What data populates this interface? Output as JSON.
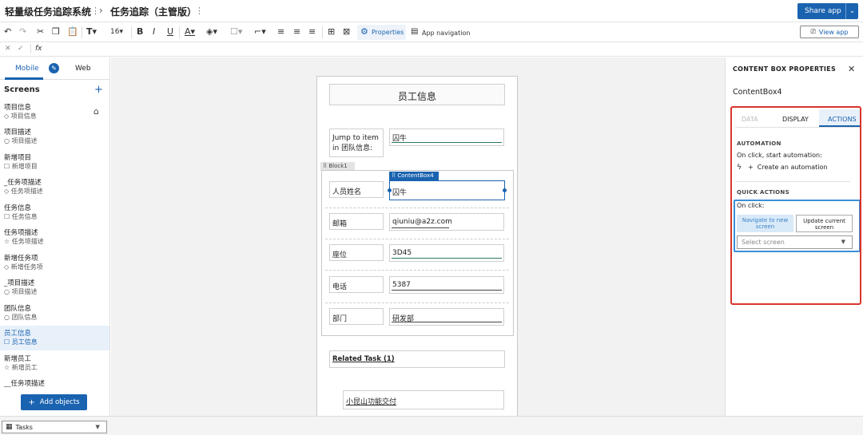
{
  "titlebar": {
    "app_name": "轻量级任务追踪系统",
    "page_name": "任务追踪（主管版）",
    "share_label": "Share app"
  },
  "toolbar": {
    "font_size": "16",
    "properties_label": "Properties",
    "app_navigation_label": "App navigation",
    "view_app_label": "View app"
  },
  "formula_bar": {
    "fx": "fx"
  },
  "left_panel": {
    "tab_mobile": "Mobile",
    "tab_web": "Web",
    "screens_heading": "Screens",
    "add_objects_label": "Add objects",
    "screens": [
      {
        "name": "项目信息",
        "sub": "项目信息"
      },
      {
        "name": "项目描述",
        "sub": "项目描述"
      },
      {
        "name": "新增项目",
        "sub": "新增项目"
      },
      {
        "name": "_任务项描述",
        "sub": "任务项描述"
      },
      {
        "name": "任务信息",
        "sub": "任务信息"
      },
      {
        "name": "任务项描述",
        "sub": "任务项描述"
      },
      {
        "name": "新增任务项",
        "sub": "新增任务项"
      },
      {
        "name": "_项目描述",
        "sub": "项目描述"
      },
      {
        "name": "团队信息",
        "sub": "团队信息"
      },
      {
        "name": "员工信息",
        "sub": "员工信息"
      },
      {
        "name": "新增员工",
        "sub": "新增员工"
      },
      {
        "name": "__任务项描述",
        "sub": ""
      }
    ]
  },
  "canvas": {
    "header": "员工信息",
    "jump_label": "Jump to item in 团队信息:",
    "jump_value": "囚牛",
    "block_label": "Block1",
    "content_box_label": "ContentBox4",
    "rows": [
      {
        "label": "人员姓名",
        "value": "囚牛"
      },
      {
        "label": "邮箱",
        "value": "qiuniu@a2z.com"
      },
      {
        "label": "座位",
        "value": "3D45"
      },
      {
        "label": "电话",
        "value": "5387"
      },
      {
        "label": "部门",
        "value": "研发部"
      }
    ],
    "related_task": "Related Task (1)",
    "task_item": "小昆山功能交付"
  },
  "right_panel": {
    "title": "CONTENT BOX PROPERTIES",
    "component_name": "ContentBox4",
    "tabs": [
      "DATA",
      "DISPLAY",
      "ACTIONS"
    ],
    "automation_heading": "AUTOMATION",
    "automation_text": "On click, start automation:",
    "create_automation": "Create an automation",
    "quick_actions_heading": "QUICK ACTIONS",
    "on_click": "On click:",
    "navigate_btn": "Navigate to new screen",
    "update_btn": "Update current screen",
    "select_placeholder": "Select screen"
  },
  "bottom": {
    "tasks_label": "Tasks"
  }
}
